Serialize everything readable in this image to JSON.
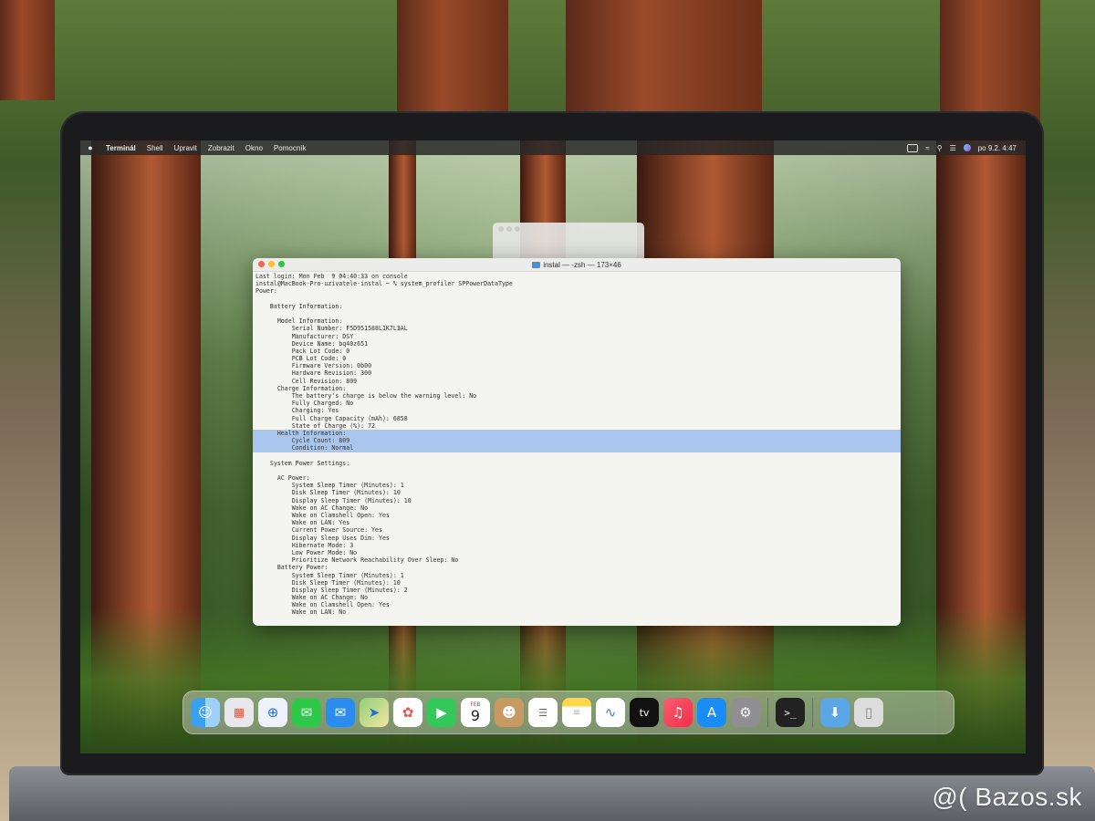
{
  "menubar": {
    "apple": "",
    "items": [
      "Terminál",
      "Shell",
      "Upravit",
      "Zobrazit",
      "Okno",
      "Pomocník"
    ],
    "clock": "po 9.2.  4:47"
  },
  "terminal": {
    "title": "instal — -zsh — 173×46",
    "lines": [
      "Last login: Mon Feb  9 04:40:33 on console",
      "instal@MacBook-Pro-uzivatele-instal ~ % system_profiler SPPowerDataType",
      "Power:",
      "",
      "    Battery Information:",
      "",
      "      Model Information:",
      "          Serial Number: F5D951588L1K7L3AL",
      "          Manufacturer: DSY",
      "          Device Name: bq40z651",
      "          Pack Lot Code: 0",
      "          PCB Lot Code: 0",
      "          Firmware Version: 0b00",
      "          Hardware Revision: 300",
      "          Cell Revision: 809",
      "      Charge Information:",
      "          The battery's charge is below the warning level: No",
      "          Fully Charged: No",
      "          Charging: Yes",
      "          Full Charge Capacity (mAh): 6858",
      "          State of Charge (%): 72",
      "      Health Information:",
      "          Cycle Count: 809",
      "          Condition: Normal",
      "",
      "    System Power Settings:",
      "",
      "      AC Power:",
      "          System Sleep Timer (Minutes): 1",
      "          Disk Sleep Timer (Minutes): 10",
      "          Display Sleep Timer (Minutes): 10",
      "          Wake on AC Change: No",
      "          Wake on Clamshell Open: Yes",
      "          Wake on LAN: Yes",
      "          Current Power Source: Yes",
      "          Display Sleep Uses Dim: Yes",
      "          Hibernate Mode: 3",
      "          Low Power Mode: No",
      "          Prioritize Network Reachability Over Sleep: No",
      "      Battery Power:",
      "          System Sleep Timer (Minutes): 1",
      "          Disk Sleep Timer (Minutes): 10",
      "          Display Sleep Timer (Minutes): 2",
      "          Wake on AC Change: No",
      "          Wake on Clamshell Open: Yes",
      "          Wake on LAN: No"
    ],
    "selection": "Health Information:\n          Cycle Count: 809\n          Condition: Normal"
  },
  "dock": {
    "calendar_month": "FEB",
    "calendar_day": "9",
    "tv_label": "tv",
    "apps": [
      "finder-icon",
      "launchpad-icon",
      "safari-icon",
      "messages-icon",
      "mail-icon",
      "maps-icon",
      "photos-icon",
      "facetime-icon",
      "calendar-icon",
      "contacts-icon",
      "reminders-icon",
      "notes-icon",
      "freeform-icon",
      "apple-tv-icon",
      "music-icon",
      "app-store-icon",
      "system-settings-icon",
      "terminal-icon",
      "downloads-icon",
      "trash-icon"
    ]
  },
  "watermark": "@( Bazos.sk"
}
